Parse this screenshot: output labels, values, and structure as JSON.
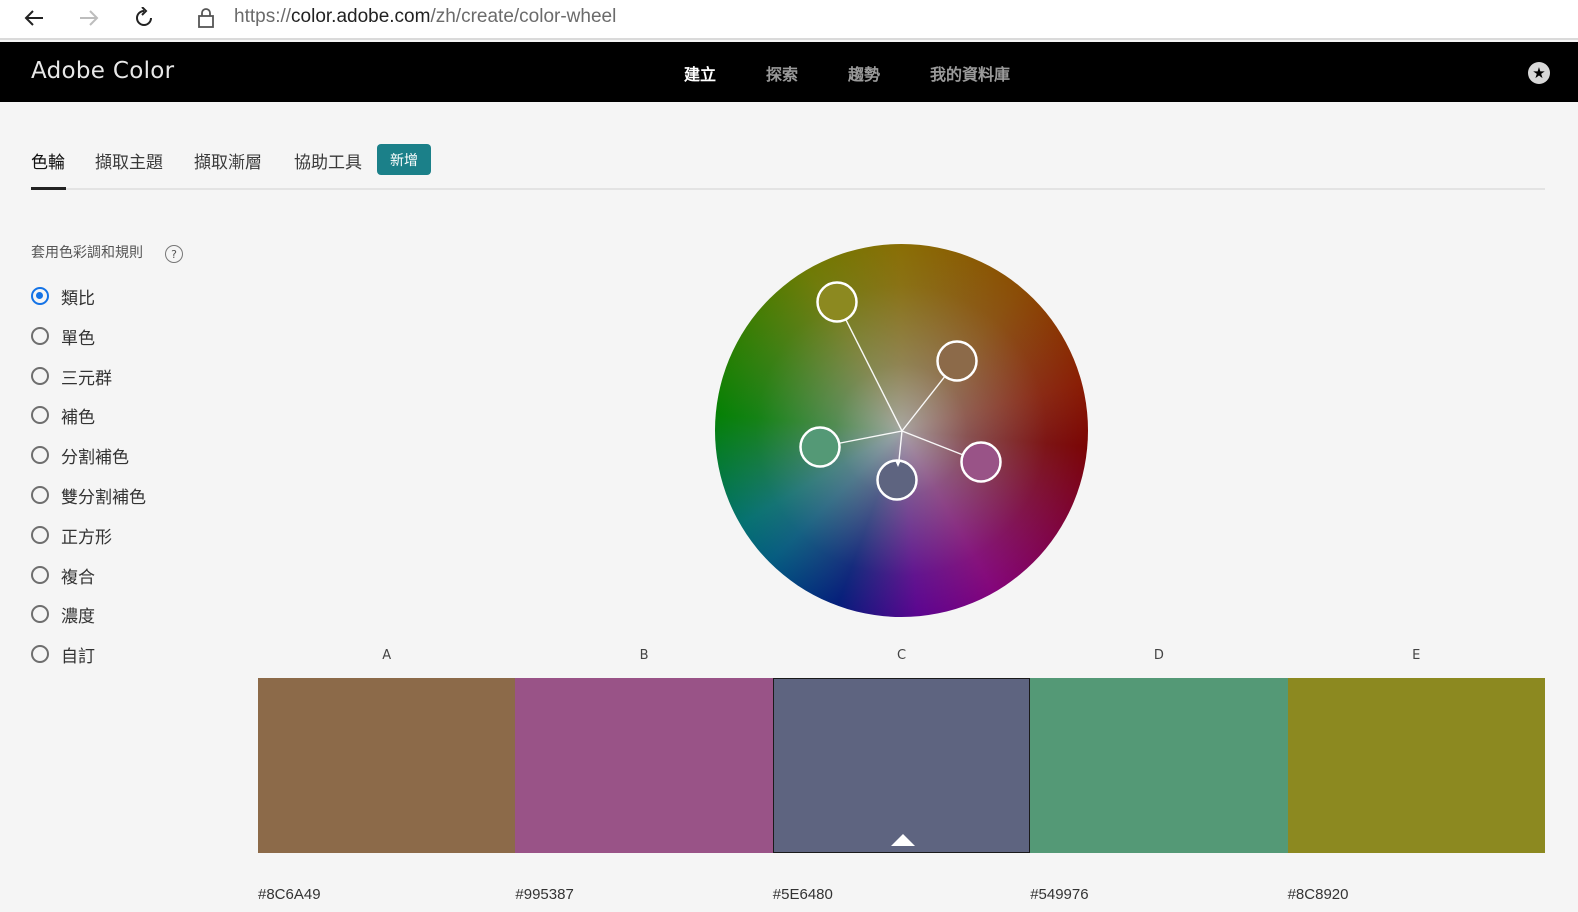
{
  "browser": {
    "url_prefix": "https://",
    "url_host": "color.adobe.com",
    "url_path": "/zh/create/color-wheel"
  },
  "app": {
    "brand": "Adobe Color",
    "nav": [
      {
        "label": "建立",
        "active": true
      },
      {
        "label": "探索",
        "active": false
      },
      {
        "label": "趨勢",
        "active": false
      },
      {
        "label": "我的資料庫",
        "active": false
      }
    ]
  },
  "subtabs": {
    "items": [
      {
        "label": "色輪",
        "active": true
      },
      {
        "label": "擷取主題",
        "active": false
      },
      {
        "label": "擷取漸層",
        "active": false
      },
      {
        "label": "協助工具",
        "active": false
      }
    ],
    "badge": "新增"
  },
  "rules": {
    "title": "套用色彩調和規則",
    "help": "?",
    "options": [
      {
        "label": "類比",
        "selected": true
      },
      {
        "label": "單色",
        "selected": false
      },
      {
        "label": "三元群",
        "selected": false
      },
      {
        "label": "補色",
        "selected": false
      },
      {
        "label": "分割補色",
        "selected": false
      },
      {
        "label": "雙分割補色",
        "selected": false
      },
      {
        "label": "正方形",
        "selected": false
      },
      {
        "label": "複合",
        "selected": false
      },
      {
        "label": "濃度",
        "selected": false
      },
      {
        "label": "自訂",
        "selected": false
      }
    ]
  },
  "palette": {
    "selected_index": 2,
    "colors": [
      {
        "label": "A",
        "hex": "#8C6A49"
      },
      {
        "label": "B",
        "hex": "#995387"
      },
      {
        "label": "C",
        "hex": "#5E6480"
      },
      {
        "label": "D",
        "hex": "#549976"
      },
      {
        "label": "E",
        "hex": "#8C8920"
      }
    ]
  }
}
